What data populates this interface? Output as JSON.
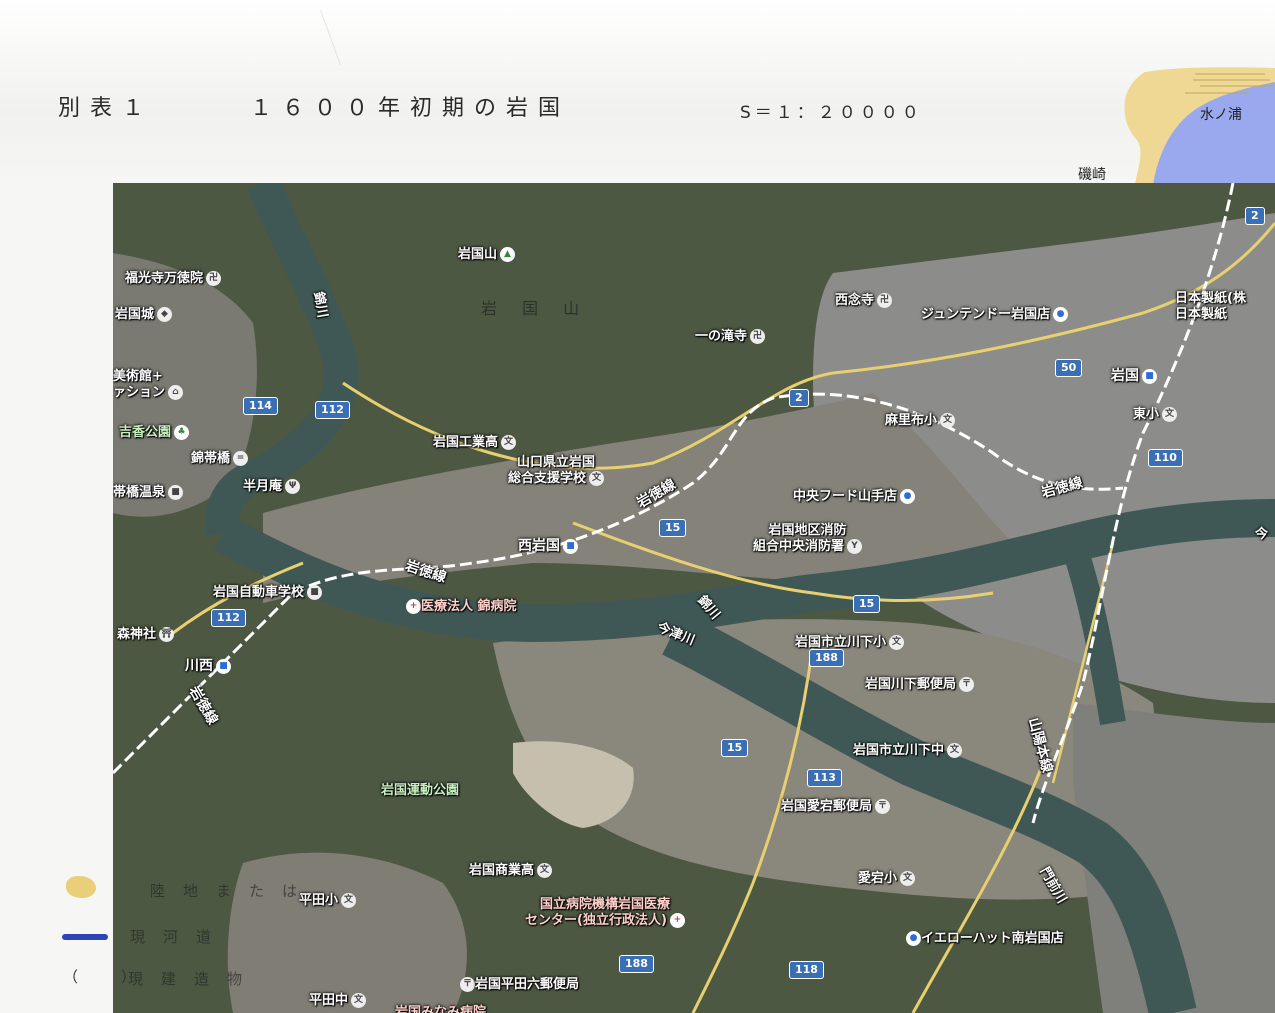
{
  "header": {
    "table_label": "別表１",
    "title": "１６００年初期の岩国",
    "scale": "S＝１：２００００"
  },
  "inset": {
    "label_mizunoura": "水ノ浦",
    "label_isozaki": "磯崎",
    "colors": {
      "land_old": "#eed893",
      "water": "#9aa9ee"
    }
  },
  "map": {
    "faded_labels": {
      "mountain_overlay": "岩 国 山"
    },
    "places": [
      {
        "id": "iwakuniyama",
        "text": "岩国山",
        "icon": "mountain-icon"
      },
      {
        "id": "fukukoji",
        "text": "福光寺万徳院",
        "icon": "temple-icon"
      },
      {
        "id": "iwakunijo",
        "text": "岩国城",
        "icon": "castle-icon"
      },
      {
        "id": "bijutsukan",
        "text": "美術館+\nァション",
        "icon": "museum-icon"
      },
      {
        "id": "kikko",
        "text": "吉香公園",
        "icon": "park-icon"
      },
      {
        "id": "kintaikyo",
        "text": "錦帯橋",
        "icon": "bridge-icon"
      },
      {
        "id": "onsen",
        "text": "帯橋温泉",
        "icon": "hotel-icon"
      },
      {
        "id": "hangetsuan",
        "text": "半月庵",
        "icon": "restaurant-icon"
      },
      {
        "id": "kogyo",
        "text": "岩国工業高",
        "icon": "school-icon"
      },
      {
        "id": "shien",
        "text": "山口県立岩国\n総合支援学校",
        "icon": "school-icon"
      },
      {
        "id": "ichinotaki",
        "text": "一の滝寺",
        "icon": "temple-icon"
      },
      {
        "id": "nishiiwakuni",
        "text": "西岩国",
        "icon": "train-icon"
      },
      {
        "id": "jidosha",
        "text": "岩国自動車学校",
        "icon": "school-icon"
      },
      {
        "id": "nishikibyoin",
        "text": "医療法人 錦病院",
        "icon": "hospital-icon"
      },
      {
        "id": "morijinja",
        "text": "森神社",
        "icon": "shrine-icon"
      },
      {
        "id": "kawanishi",
        "text": "川西",
        "icon": "train-icon"
      },
      {
        "id": "saionji",
        "text": "西念寺",
        "icon": "temple-icon"
      },
      {
        "id": "juntendo",
        "text": "ジュンテンドー岩国店",
        "icon": "shop-icon"
      },
      {
        "id": "nipponseishi",
        "text": "日本製紙(株\n日本製紙",
        "icon": "factory-icon"
      },
      {
        "id": "iwakuni",
        "text": "岩国",
        "icon": "train-icon"
      },
      {
        "id": "higashisho",
        "text": "東小",
        "icon": "school-icon"
      },
      {
        "id": "asafu",
        "text": "麻里布小",
        "icon": "school-icon"
      },
      {
        "id": "chuofood",
        "text": "中央フード山手店",
        "icon": "shop-icon"
      },
      {
        "id": "shobo",
        "text": "岩国地区消防\n組合中央消防署",
        "icon": "fire-station-icon"
      },
      {
        "id": "kawashimosho",
        "text": "岩国市立川下小",
        "icon": "school-icon"
      },
      {
        "id": "kawashimoyubin",
        "text": "岩国川下郵便局",
        "icon": "post-office-icon"
      },
      {
        "id": "kawashimochu",
        "text": "岩国市立川下中",
        "icon": "school-icon"
      },
      {
        "id": "undokoen",
        "text": "岩国運動公園",
        "icon": ""
      },
      {
        "id": "atagoyubin",
        "text": "岩国愛宕郵便局",
        "icon": "post-office-icon"
      },
      {
        "id": "shogyo",
        "text": "岩国商業高",
        "icon": "school-icon"
      },
      {
        "id": "atagosho",
        "text": "愛宕小",
        "icon": "school-icon"
      },
      {
        "id": "hiratasho",
        "text": "平田小",
        "icon": "school-icon"
      },
      {
        "id": "iryocenter",
        "text": "国立病院機構岩国医療\nセンター(独立行政法人)",
        "icon": "hospital-icon"
      },
      {
        "id": "yellowhat",
        "text": "イエローハット南岩国店",
        "icon": "shop-icon"
      },
      {
        "id": "hiratayubin",
        "text": "岩国平田六郵便局",
        "icon": "post-office-icon"
      },
      {
        "id": "hiratachu",
        "text": "平田中",
        "icon": "school-icon"
      },
      {
        "id": "minamibyoin",
        "text": "岩国みなみ病院",
        "icon": "hospital-icon"
      },
      {
        "id": "ima",
        "text": "今",
        "icon": ""
      }
    ],
    "water_labels": [
      {
        "id": "nishikigawa-1",
        "text": "錦川"
      },
      {
        "id": "nishikigawa-2",
        "text": "錦川"
      },
      {
        "id": "imazugawa",
        "text": "今津川"
      },
      {
        "id": "monzengawa",
        "text": "門前川"
      }
    ],
    "rail_labels": [
      {
        "id": "gantoku-1",
        "text": "岩徳線"
      },
      {
        "id": "gantoku-2",
        "text": "岩徳線"
      },
      {
        "id": "gantoku-3",
        "text": "岩徳線"
      },
      {
        "id": "gantoku-4",
        "text": "岩徳線"
      },
      {
        "id": "sanyo",
        "text": "山陽本線"
      }
    ],
    "route_shields": [
      "2",
      "2",
      "50",
      "110",
      "114",
      "112",
      "112",
      "15",
      "15",
      "15",
      "188",
      "113",
      "188",
      "118"
    ],
    "colors": {
      "forest": "#4d5843",
      "urban": "#8c8c8a",
      "river": "#3f5856",
      "road": "#e8d070",
      "rail": "#ffffff",
      "shield": "#3a6fb5"
    }
  },
  "legend": {
    "item_old_land": "陸地または",
    "item_river": "現河道",
    "item_building_mark": "（　）",
    "item_building": "現建造物",
    "colors": {
      "old_land": "#e9cf7a",
      "river": "#2c44b8"
    }
  }
}
